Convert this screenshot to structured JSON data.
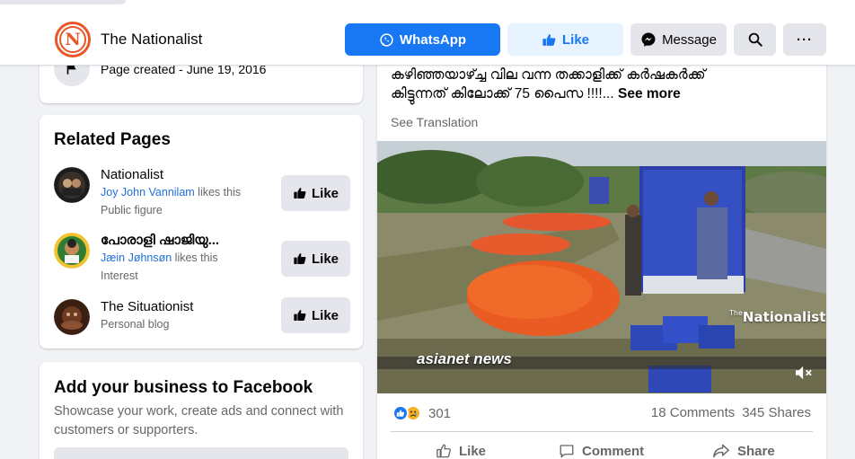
{
  "header": {
    "logo_letter": "N",
    "page_name": "The Nationalist",
    "whatsapp_label": "WhatsApp",
    "like_label": "Like",
    "message_label": "Message",
    "more_label": "···",
    "accent_color": "#1877f2"
  },
  "intro": {
    "page_created": "Page created - June 19, 2016"
  },
  "related_pages": {
    "title": "Related Pages",
    "items": [
      {
        "name": "Nationalist",
        "liker": "Joy John Vannilam",
        "likes_text": " likes this",
        "category": "Public figure",
        "like_label": "Like"
      },
      {
        "name": "പോരാളി ഷാജിയു...",
        "liker": "Jæin Jøhnsøn",
        "likes_text": " likes this",
        "category": "Interest",
        "like_label": "Like"
      },
      {
        "name": "The Situationist",
        "category": "Personal blog",
        "like_label": "Like"
      }
    ]
  },
  "business": {
    "title": "Add your business to Facebook",
    "description": "Showcase your work, create ads and connect with customers or supporters."
  },
  "post": {
    "text_line1": "കഴിഞ്ഞയാഴ്ച്ച വില വന്ന തക്കാളിക്ക് കർഷകർക്ക്",
    "text_line2": "കിട്ടുന്നത് കിലോക്ക് 75 പൈസ !!!!...",
    "see_more": "See more",
    "see_translation": "See Translation",
    "video_watermark_small": "The",
    "video_watermark": "Nationalist",
    "video_channel": "asianet news",
    "reaction_count": "301",
    "comments": "18 Comments",
    "shares": "345 Shares",
    "action_like": "Like",
    "action_comment": "Comment",
    "action_share": "Share"
  }
}
